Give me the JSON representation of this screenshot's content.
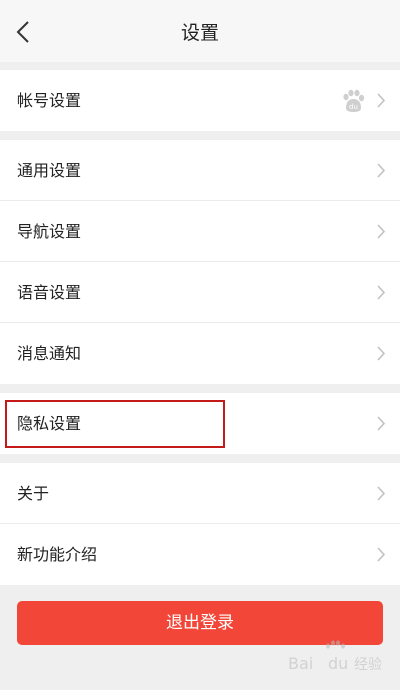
{
  "header": {
    "title": "设置"
  },
  "sections": [
    {
      "items": [
        {
          "label": "帐号设置",
          "icon": "baidu-paw-icon"
        }
      ]
    },
    {
      "items": [
        {
          "label": "通用设置"
        },
        {
          "label": "导航设置"
        },
        {
          "label": "语音设置"
        },
        {
          "label": "消息通知"
        }
      ]
    },
    {
      "items": [
        {
          "label": "隐私设置",
          "highlighted": true
        }
      ]
    },
    {
      "items": [
        {
          "label": "关于"
        },
        {
          "label": "新功能介绍"
        }
      ]
    }
  ],
  "logout_button": {
    "label": "退出登录"
  },
  "colors": {
    "accent": "#f24638",
    "highlight": "#c41a1a",
    "background": "#efefef"
  }
}
